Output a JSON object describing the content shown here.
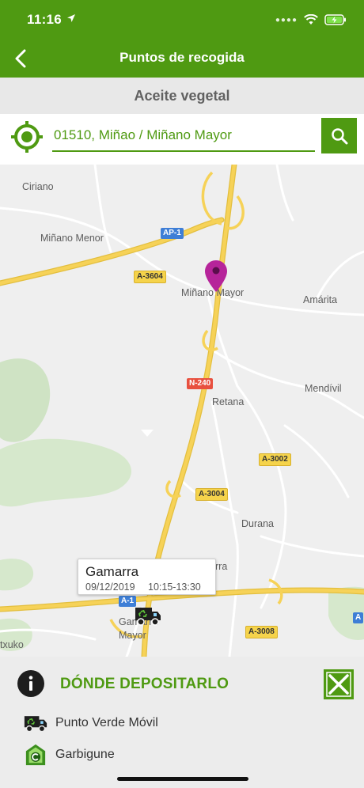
{
  "status_bar": {
    "time": "11:16"
  },
  "nav": {
    "title": "Puntos de recogida"
  },
  "subheader": {
    "title": "Aceite vegetal"
  },
  "search": {
    "value": "01510, Miñao / Miñano Mayor"
  },
  "map": {
    "places": [
      "Ciriano",
      "Miñano Menor",
      "Miñano Mayor",
      "Amárita",
      "Mendívil",
      "Retana",
      "Durana",
      "Gamarra Mayor",
      "rra",
      "txuko"
    ],
    "road_shields": {
      "ap1": "AP-1",
      "a3604": "A-3604",
      "n240": "N-240",
      "a3002": "A-3002",
      "a3004": "A-3004",
      "a1": "A-1",
      "a3008": "A-3008",
      "a_edge": "A"
    },
    "callout": {
      "title": "Gamarra",
      "date": "09/12/2019",
      "time": "10:15-13:30"
    },
    "colors": {
      "pin": "#b6249a",
      "road_major": "#f6d258",
      "road_minor": "#ffffff",
      "park": "#cfe3c4"
    }
  },
  "panel": {
    "title": "DÓNDE DEPOSITARLO",
    "items": [
      {
        "label": "Punto Verde Móvil",
        "icon": "truck-icon"
      },
      {
        "label": "Garbigune",
        "icon": "garbigune-icon"
      }
    ]
  },
  "colors": {
    "brand": "#4f9a12",
    "subheader_bg": "#e8e8e8",
    "panel_bg": "#ececec"
  }
}
